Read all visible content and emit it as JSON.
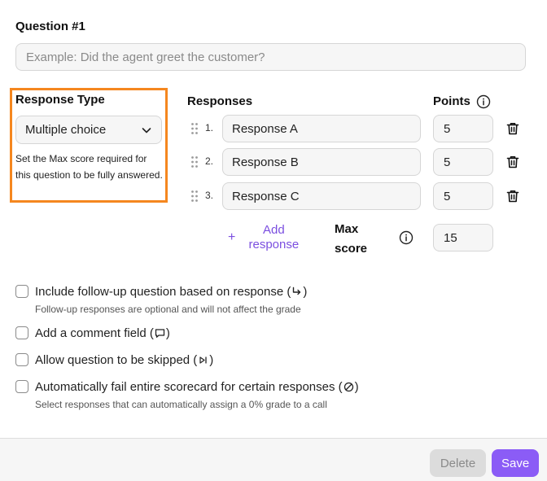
{
  "question": {
    "label": "Question #1",
    "placeholder": "Example: Did the agent greet the customer?",
    "value": ""
  },
  "response_type": {
    "title": "Response Type",
    "selected": "Multiple choice",
    "description": "Set the Max score required for this question to be fully answered.",
    "highlight_color": "#f5871f"
  },
  "responses": {
    "header": "Responses",
    "points_header": "Points",
    "items": [
      {
        "number": "1.",
        "value": "Response A",
        "points": "5"
      },
      {
        "number": "2.",
        "value": "Response B",
        "points": "5"
      },
      {
        "number": "3.",
        "value": "Response C",
        "points": "5"
      }
    ],
    "add_label": "Add response",
    "add_symbol": "+",
    "max_score_label": "Max score",
    "max_score_value": "15"
  },
  "options": [
    {
      "label": "Include follow-up question based on response (",
      "close": ")",
      "icon": "follow-up-arrow-icon",
      "sub": "Follow-up responses are optional and will not affect the grade",
      "checked": false
    },
    {
      "label": "Add a comment field (",
      "close": ")",
      "icon": "comment-icon",
      "sub": "",
      "checked": false
    },
    {
      "label": "Allow question to be skipped (",
      "close": ")",
      "icon": "skip-icon",
      "sub": "",
      "checked": false
    },
    {
      "label": "Automatically fail entire scorecard for certain responses (",
      "close": ")",
      "icon": "no-entry-icon",
      "sub": "Select responses that can automatically assign a 0% grade to a call",
      "checked": false
    }
  ],
  "footer": {
    "delete_label": "Delete",
    "save_label": "Save"
  },
  "colors": {
    "accent": "#8b5cf6",
    "link": "#7b4fe0"
  }
}
